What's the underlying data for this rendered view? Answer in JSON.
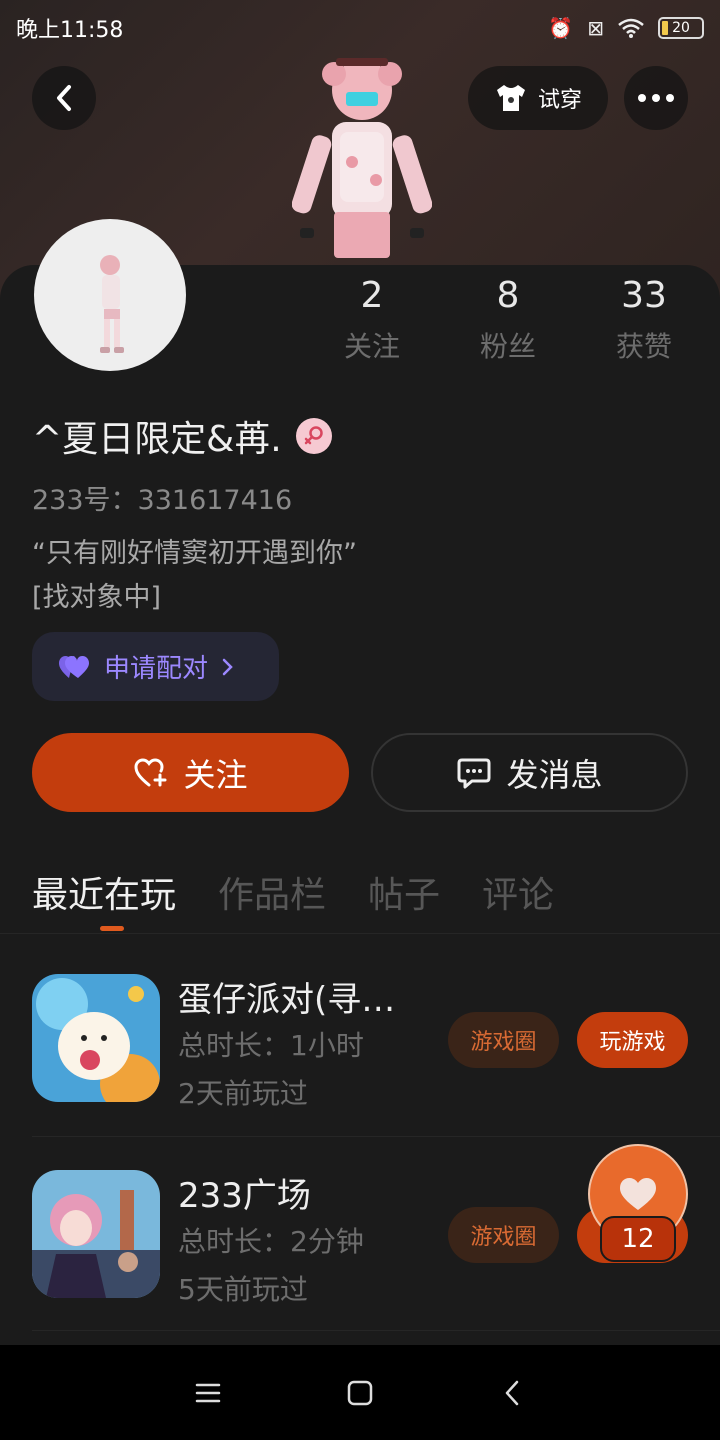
{
  "status_bar": {
    "time": "晚上11:58",
    "battery": "20"
  },
  "header": {
    "tryon_label": "试穿"
  },
  "stats": [
    {
      "value": "2",
      "label": "关注"
    },
    {
      "value": "8",
      "label": "粉丝"
    },
    {
      "value": "33",
      "label": "获赞"
    }
  ],
  "profile": {
    "username": "^夏日限定&苒.",
    "user_id": "233号：331617416",
    "bio": "“只有刚好情窦初开遇到你”\n[找对象中]",
    "match_label": "申请配对"
  },
  "actions": {
    "follow_label": "关注",
    "message_label": "发消息"
  },
  "tabs": [
    {
      "label": "最近在玩",
      "active": true
    },
    {
      "label": "作品栏",
      "active": false
    },
    {
      "label": "帖子",
      "active": false
    },
    {
      "label": "评论",
      "active": false
    }
  ],
  "games": [
    {
      "name": "蛋仔派对(寻…",
      "duration": "总时长：1小时",
      "last_played": "2天前玩过",
      "circle_label": "游戏圈",
      "play_label": "玩游戏"
    },
    {
      "name": "233广场",
      "duration": "总时长：2分钟",
      "last_played": "5天前玩过",
      "circle_label": "游戏圈",
      "play_label": "玩游戏"
    }
  ],
  "like_float": {
    "count": "12"
  },
  "colors": {
    "accent": "#c33d0d",
    "match": "#9c88ff",
    "background": "#181818"
  }
}
